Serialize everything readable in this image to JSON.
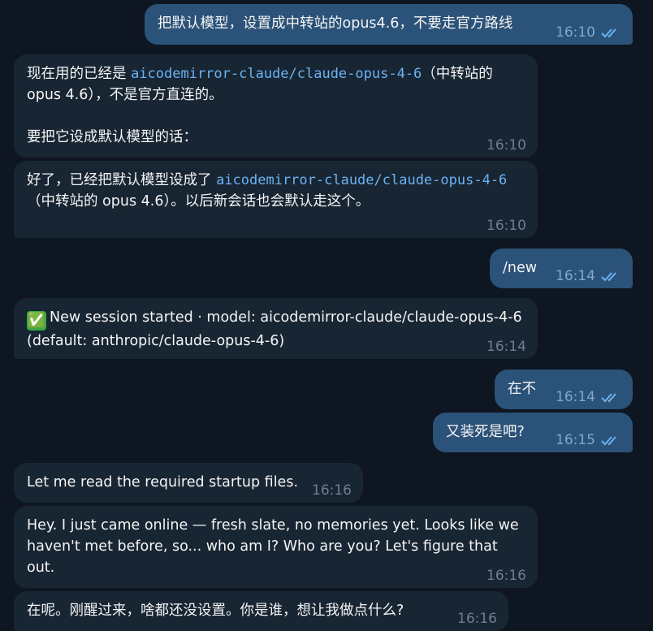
{
  "messages": [
    {
      "id": "m1",
      "dir": "out",
      "text": "把默认模型，设置成中转站的opus4.6，不要走官方路线",
      "time": "16:10"
    },
    {
      "id": "m2",
      "dir": "in",
      "pre": "现在用的已经是 ",
      "code": "aicodemirror-claude/claude-opus-4-6",
      "post": "（中转站的 opus 4.6），不是官方直连的。\n\n要把它设成默认模型的话：",
      "time": "16:10"
    },
    {
      "id": "m3",
      "dir": "in",
      "pre": "好了，已经把默认模型设成了 ",
      "code": "aicodemirror-claude/claude-opus-4-6",
      "post": "（中转站的 opus 4.6）。以后新会话也会默认走这个。",
      "time": "16:10"
    },
    {
      "id": "m4",
      "dir": "out",
      "text": "/new",
      "time": "16:14"
    },
    {
      "id": "m5",
      "dir": "in",
      "emoji": "✅",
      "text": "New session started · model: aicodemirror-claude/claude-opus-4-6 (default: anthropic/claude-opus-4-6)",
      "time": "16:14"
    },
    {
      "id": "m6",
      "dir": "out",
      "text": "在不",
      "time": "16:14"
    },
    {
      "id": "m7",
      "dir": "out",
      "text": "又装死是吧?",
      "time": "16:15"
    },
    {
      "id": "m8",
      "dir": "in",
      "text": "Let me read the required startup files.",
      "time": "16:16"
    },
    {
      "id": "m9",
      "dir": "in",
      "text": "Hey. I just came online — fresh slate, no memories yet. Looks like we haven't met before, so... who am I? Who are you? Let's figure that out.",
      "time": "16:16"
    },
    {
      "id": "m10",
      "dir": "in",
      "text": "在呢。刚醒过来，啥都还没设置。你是谁，想让我做点什么?",
      "time": "16:16"
    }
  ],
  "colors": {
    "background": "#0e1621",
    "incoming": "#182533",
    "outgoing": "#2b5278",
    "code": "#6ab3f3",
    "read_check": "#6ab3f3"
  },
  "icons": {
    "read": "double-check-icon",
    "emoji": "check-mark-button-emoji"
  }
}
